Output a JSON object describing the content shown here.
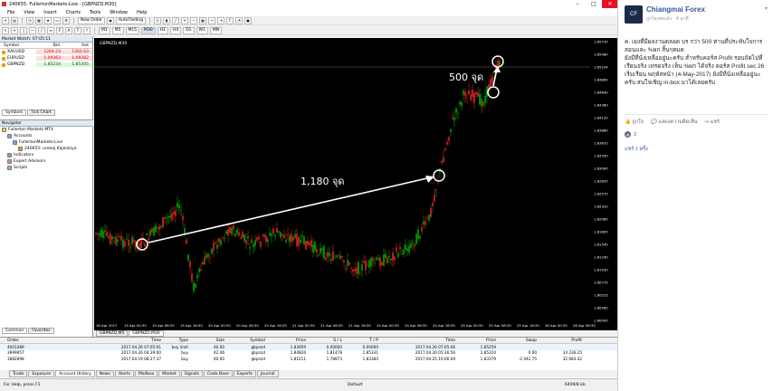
{
  "window": {
    "title": "240655: FullertonMarkets-Live - [GBPNZD,M30]"
  },
  "menu": [
    "File",
    "View",
    "Insert",
    "Charts",
    "Tools",
    "Window",
    "Help"
  ],
  "toolbar": {
    "new_order": "New Order",
    "autotrading": "AutoTrading",
    "timeframes": [
      "M1",
      "M5",
      "M15",
      "M30",
      "H1",
      "H4",
      "D1",
      "W1",
      "MN"
    ]
  },
  "market_watch": {
    "title": "Market Watch: 07:05:11",
    "headers": [
      "Symbol",
      "Bid",
      "Ask"
    ],
    "rows": [
      {
        "symbol": "XAUUSD",
        "bid": "1264.23",
        "ask": "1264.63"
      },
      {
        "symbol": "EURUSD",
        "bid": "1.09363",
        "ask": "1.09382"
      },
      {
        "symbol": "GBPNZD",
        "bid": "1.85234",
        "ask": "1.85305"
      }
    ],
    "tabs": [
      "Symbols",
      "Tick Chart"
    ]
  },
  "navigator": {
    "title": "Navigator",
    "items": [
      "Fullerton Markets MT4",
      "Accounts",
      "FullertonMarkets-Live",
      "240655: ureeaj Kajonkiya",
      "Indicators",
      "Expert Advisors",
      "Scripts"
    ],
    "tabs": [
      "Common",
      "Favorites"
    ]
  },
  "chart": {
    "label": "GBPNZD,M30",
    "annotation_1": "1,180  จุด",
    "annotation_2": "500  จุด",
    "price_axis": [
      "1.85735",
      "1.85480",
      "1.85234",
      "1.84890",
      "1.84640",
      "1.84380",
      "1.84120",
      "1.83860",
      "1.83610",
      "1.83350",
      "1.83090",
      "1.82835",
      "1.82575",
      "1.82320",
      "1.82060",
      "1.81805",
      "1.81545",
      "1.81290",
      "1.81030",
      "1.80775",
      "1.80515",
      "1.80260",
      "1.80000"
    ],
    "time_axis": [
      "18 Apr 2017",
      "19 Apr 00:30",
      "19 Apr 08:30",
      "19 Apr 16:30",
      "20 Apr 00:30",
      "20 Apr 08:30",
      "20 Apr 16:30",
      "21 Apr 00:30",
      "21 Apr 08:30",
      "21 Apr 16:30",
      "24 Apr 00:30",
      "24 Apr 08:30",
      "24 Apr 16:30",
      "25 Apr 00:30",
      "25 Apr 08:30",
      "25 Apr 16:30",
      "26 Apr 00:30",
      "26 Apr 08:30"
    ],
    "tabs": [
      "GBPNZD,M5",
      "GBPNZD,M30"
    ]
  },
  "terminal": {
    "headers": [
      "Order",
      "Time",
      "Type",
      "Size",
      "Symbol",
      "Price",
      "S / L",
      "T / P",
      "Time",
      "Price",
      "Swap",
      "Profit"
    ],
    "rows": [
      [
        "4001489",
        "2017.04.26 07:05:01",
        "buy limit",
        "40.00",
        "gbpnzd",
        "1.83959",
        "0.00000",
        "0.00000",
        "2017.04.26 07:05:06",
        "1.85259",
        "",
        ""
      ],
      [
        "3999957",
        "2017.04.26 04:39:00",
        "buy",
        "42.46",
        "gbpnzd",
        "1.84826",
        "1.81478",
        "1.85331",
        "2017.04.26 05:36:56",
        "1.85310",
        "0.00",
        "14 236.25"
      ],
      [
        "3882898",
        "2017.04.19 08:27:37",
        "buy",
        "40.00",
        "gbpnzd",
        "1.81211",
        "1.78873",
        "1.83384",
        "2017.04.25 10:06:09",
        "1.83379",
        "-2 042.75",
        "32 683.42"
      ]
    ],
    "tabs": [
      "Trade",
      "Exposure",
      "Account History",
      "News",
      "Alerts",
      "Mailbox",
      "Market",
      "Signals",
      "Code Base",
      "Experts",
      "Journal"
    ]
  },
  "status": {
    "help": "For Help, press F1",
    "profile": "Default",
    "conn": "6409/8 kb"
  },
  "post": {
    "author": "Chiangmai Forex",
    "meta": "ถูกใจเพจแล้ว · 4 นาที",
    "text": "ค. เยงที่มีผลงานตลอด  บร กว่า 500 ท่านที่ประทับใจการสอนและ %ผก สิ้นๆหมด\nยังมีที่นั่งเหลืออยู่นะครับ สำหรับคอร์ส Profit รอบถัดไปที่เรียนจริง เทรดจริง เห็น %ผก ได้จริง คอร์ส Profit sec 26 เริ่มเรียน พฤหัสหน้า (4-May-2017) ยังมีที่นั่งเหลืออยู่นะครับ สนใจเชิญ in-box มาได้เลยครับ",
    "actions": [
      "ถูกใจ",
      "แสดงความคิดเห็น",
      "แชร์"
    ],
    "likes": "3",
    "shares": "แชร์ 1 ครั้ง"
  },
  "colors": {
    "bull": "#00c000",
    "bear": "#ff2a2a",
    "chart_bg": "#000000"
  }
}
